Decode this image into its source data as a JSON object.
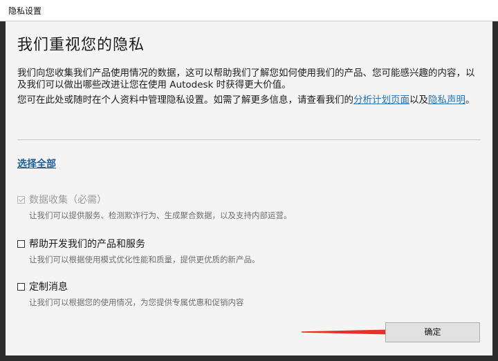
{
  "window": {
    "title": "隐私设置"
  },
  "heading": "我们重视您的隐私",
  "intro": {
    "line1": "我们向您收集我们产品使用情况的数据，这可以帮助我们了解您如何使用我们的产品、您可能感兴趣的内容，以及我们可以做出哪些改进让您在使用 Autodesk 时获得更大价值。",
    "line2_prefix": "您可在此处或随时在个人资料中管理隐私设置。如需了解更多信息，请查看我们的",
    "link_analytics": "分析计划页面",
    "line2_mid": "以及",
    "link_privacy": "隐私声明",
    "line2_suffix": "。"
  },
  "select_all": "选择全部",
  "options": [
    {
      "label": "数据收集（必需）",
      "desc": "让我们可以提供服务、检测欺诈行为、生成聚合数据，以及支持内部运营。",
      "checked": true,
      "disabled": true
    },
    {
      "label": "帮助开发我们的产品和服务",
      "desc": "让我们可以根据使用模式优化性能和质量，提供更优质的新产品。",
      "checked": false,
      "disabled": false
    },
    {
      "label": "定制消息",
      "desc": "让我们可以根据您的使用情况，为您提供专属优惠和促销内容",
      "checked": false,
      "disabled": false
    }
  ],
  "ok_button": "确定",
  "colors": {
    "link": "#2a74b8",
    "arrow": "#e8302a",
    "panel": "#f4f4f4",
    "frame": "#2c2c2c"
  }
}
